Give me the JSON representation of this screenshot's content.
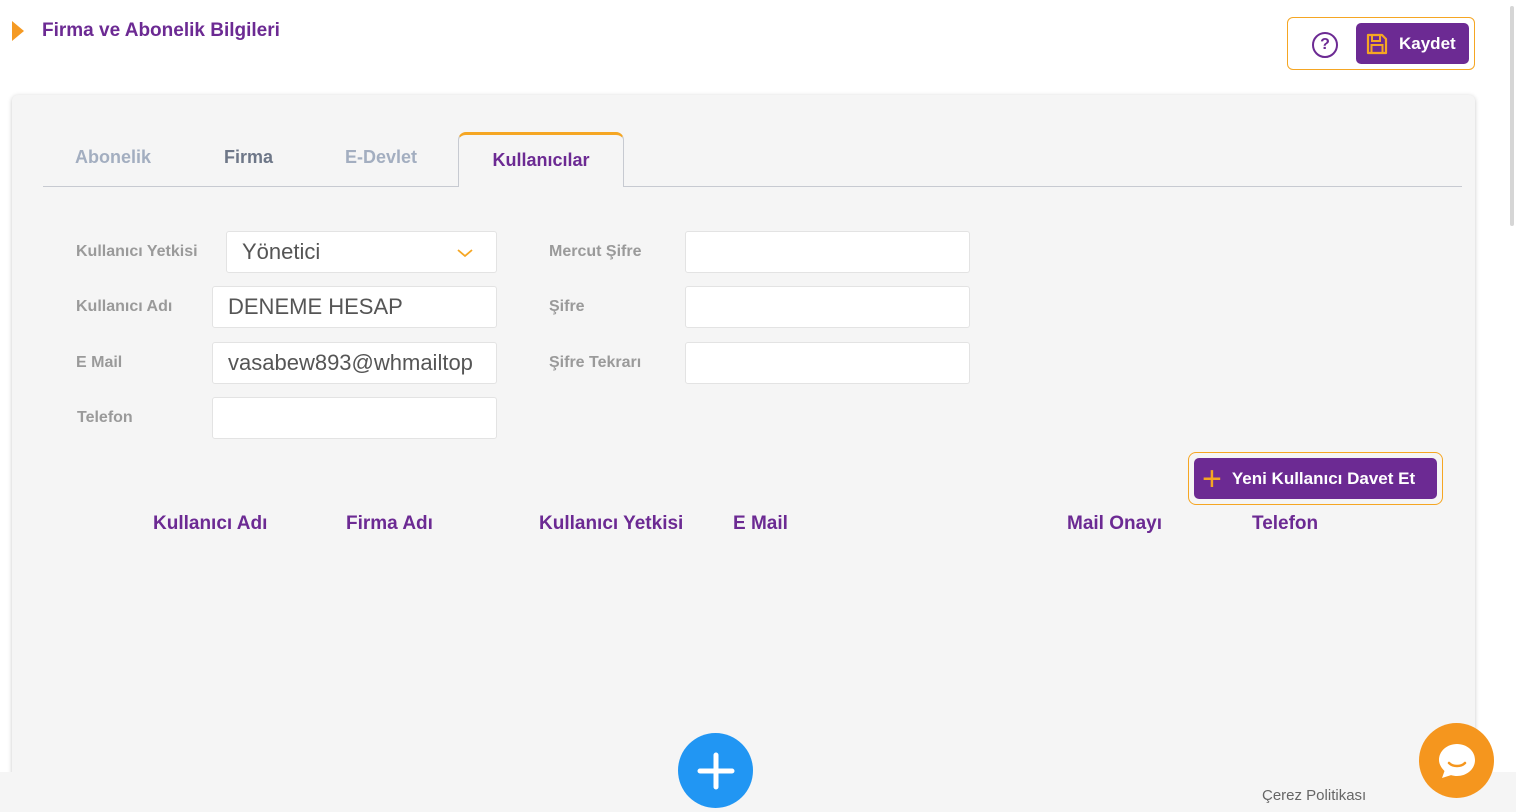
{
  "header": {
    "title": "Firma ve Abonelik Bilgileri"
  },
  "actions": {
    "help_label": "?",
    "save_label": "Kaydet"
  },
  "tabs": [
    {
      "label": "Abonelik"
    },
    {
      "label": "Firma"
    },
    {
      "label": "E-Devlet"
    },
    {
      "label": "Kullanıcılar"
    }
  ],
  "form": {
    "role": {
      "label": "Kullanıcı Yetkisi",
      "value": "Yönetici"
    },
    "username": {
      "label": "Kullanıcı Adı",
      "value": "DENEME HESAP"
    },
    "email": {
      "label": "E Mail",
      "value": "vasabew893@whmailtop"
    },
    "phone": {
      "label": "Telefon",
      "value": ""
    },
    "current_password": {
      "label": "Mercut Şifre",
      "value": ""
    },
    "password": {
      "label": "Şifre",
      "value": ""
    },
    "password_repeat": {
      "label": "Şifre Tekrarı",
      "value": ""
    }
  },
  "invite_button": {
    "label": "Yeni Kullanıcı Davet Et"
  },
  "table": {
    "headers": [
      "Kullanıcı Adı",
      "Firma Adı",
      "Kullanıcı Yetkisi",
      "E Mail",
      "Mail Onayı",
      "Telefon"
    ],
    "rows": []
  },
  "footer": {
    "cookie_policy": "Çerez Politikası"
  },
  "colors": {
    "primary": "#6c2a93",
    "accent": "#f5a623",
    "fab": "#2196f3",
    "chat": "#f5961e"
  },
  "icons": {
    "header_marker": "triangle-right-icon",
    "help": "question-circle-icon",
    "save": "floppy-disk-icon",
    "select": "chevron-down-icon",
    "invite": "plus-icon",
    "fab": "plus-icon",
    "chat": "chat-bubble-icon"
  }
}
